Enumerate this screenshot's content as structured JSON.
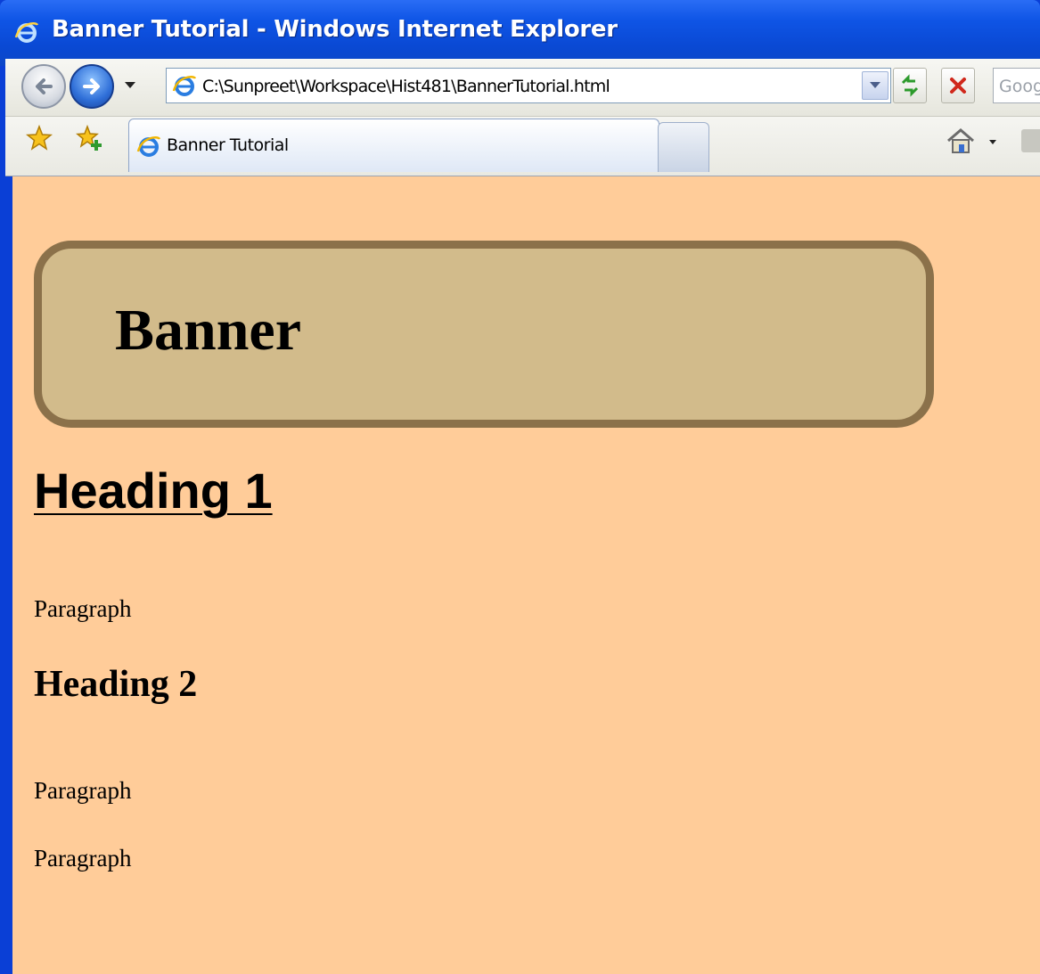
{
  "window": {
    "title": "Banner Tutorial - Windows Internet Explorer",
    "title_bar_color": "#0a49d4"
  },
  "navbar": {
    "back_icon": "back-arrow-icon",
    "forward_icon": "forward-arrow-icon",
    "address": "C:\\Sunpreet\\Workspace\\Hist481\\BannerTutorial.html",
    "search_placeholder": "Goog"
  },
  "tabs": {
    "active_label": "Banner Tutorial"
  },
  "page": {
    "background": "#ffcc99",
    "banner_color": "#d2bb8b",
    "banner_border_color": "#8b714a",
    "banner_text": "Banner",
    "heading1": "Heading 1",
    "paragraph1": "Paragraph",
    "heading2": "Heading 2",
    "paragraph2": "Paragraph",
    "paragraph3": "Paragraph"
  }
}
